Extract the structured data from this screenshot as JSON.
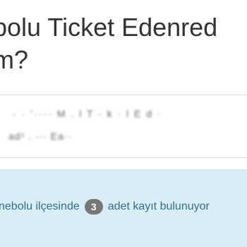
{
  "header": {
    "title_line1": "bolu Ticket Edenred",
    "title_line2": "m?"
  },
  "info_panel": {
    "line1": "·  ·  ’····         M  .  l T · k  · l  E d  ·",
    "line2": "ad¹ .             ···  Ea··"
  },
  "results": {
    "prefix": "nebolu ilçesinde",
    "count": "3",
    "suffix": "adet kayıt bulunuyor"
  }
}
